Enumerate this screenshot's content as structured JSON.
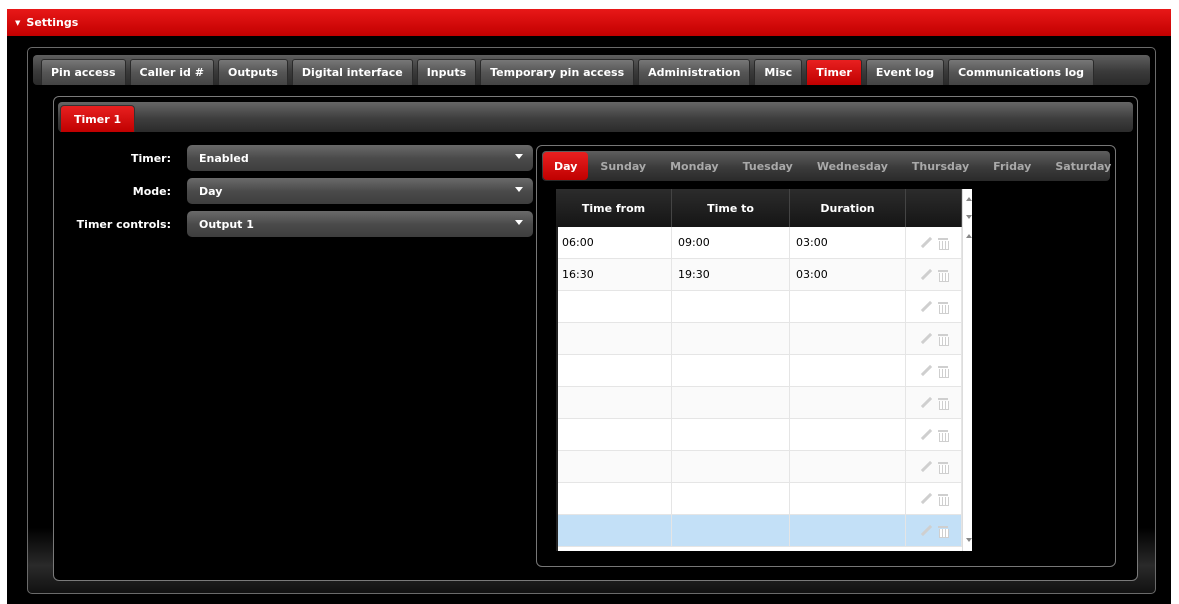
{
  "window": {
    "title": "Settings"
  },
  "main_tabs": [
    {
      "label": "Pin access",
      "active": false
    },
    {
      "label": "Caller id #",
      "active": false
    },
    {
      "label": "Outputs",
      "active": false
    },
    {
      "label": "Digital interface",
      "active": false
    },
    {
      "label": "Inputs",
      "active": false
    },
    {
      "label": "Temporary pin access",
      "active": false
    },
    {
      "label": "Administration",
      "active": false
    },
    {
      "label": "Misc",
      "active": false
    },
    {
      "label": "Timer",
      "active": true
    },
    {
      "label": "Event log",
      "active": false
    },
    {
      "label": "Communications log",
      "active": false
    }
  ],
  "sub_tabs": [
    {
      "label": "Timer 1",
      "active": true
    }
  ],
  "form": {
    "timer": {
      "label": "Timer:",
      "value": "Enabled"
    },
    "mode": {
      "label": "Mode:",
      "value": "Day"
    },
    "controls": {
      "label": "Timer controls:",
      "value": "Output 1"
    }
  },
  "day_tabs": [
    {
      "label": "Day",
      "active": true
    },
    {
      "label": "Sunday",
      "active": false
    },
    {
      "label": "Monday",
      "active": false
    },
    {
      "label": "Tuesday",
      "active": false
    },
    {
      "label": "Wednesday",
      "active": false
    },
    {
      "label": "Thursday",
      "active": false
    },
    {
      "label": "Friday",
      "active": false
    },
    {
      "label": "Saturday",
      "active": false
    }
  ],
  "grid": {
    "columns": [
      "Time from",
      "Time to",
      "Duration",
      ""
    ],
    "rows": [
      {
        "from": "06:00",
        "to": "09:00",
        "duration": "03:00"
      },
      {
        "from": "16:30",
        "to": "19:30",
        "duration": "03:00"
      },
      {
        "from": "",
        "to": "",
        "duration": ""
      },
      {
        "from": "",
        "to": "",
        "duration": ""
      },
      {
        "from": "",
        "to": "",
        "duration": ""
      },
      {
        "from": "",
        "to": "",
        "duration": ""
      },
      {
        "from": "",
        "to": "",
        "duration": ""
      },
      {
        "from": "",
        "to": "",
        "duration": ""
      },
      {
        "from": "",
        "to": "",
        "duration": ""
      },
      {
        "from": "",
        "to": "",
        "duration": ""
      }
    ],
    "selected_row": 9
  },
  "colors": {
    "accent": "#d00000",
    "selected_row": "#c3e0f7"
  }
}
